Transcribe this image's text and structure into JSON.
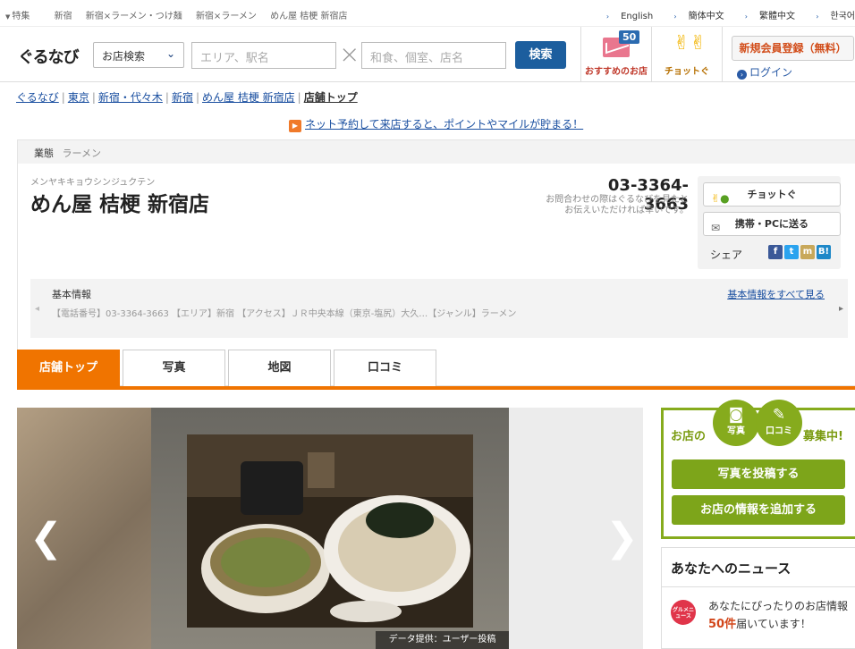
{
  "topbar": {
    "links": [
      "特集",
      "新宿",
      "新宿×ラーメン・つけ麺",
      "新宿×ラーメン",
      "めん屋 桔梗 新宿店"
    ],
    "languages": [
      "English",
      "簡体中文",
      "繁體中文",
      "한국어"
    ]
  },
  "header": {
    "logo": "ぐるなび",
    "search_mode": "お店検索",
    "area_placeholder": "エリア、駅名",
    "keyword_placeholder": "和食、個室、店名",
    "search_button": "検索",
    "recommend_label": "おすすめのお店",
    "recommend_count": "50",
    "chotto_label": "チョットぐ",
    "register_button": "新規会員登録（無料）",
    "login_link": "ログイン"
  },
  "breadcrumb": [
    "ぐるなび",
    "東京",
    "新宿・代々木",
    "新宿",
    "めん屋 桔梗 新宿店",
    "店舗トップ"
  ],
  "promo": "ネット予約して来店すると、ポイントやマイルが貯まる！",
  "shop": {
    "category_key": "業態",
    "category_value": "ラーメン",
    "kana": "メンヤキキョウシンジュクテン",
    "name": "めん屋 桔梗 新宿店",
    "tel": "03-3364-3663",
    "tel_note_1": "お問合わせの際はぐるなびを見たと",
    "tel_note_2": "お伝えいただければ幸いです。"
  },
  "actions": {
    "chotto": "チョットぐ",
    "send": "携帯・PCに送る",
    "share": "シェア"
  },
  "basic_info": {
    "title": "基本情報",
    "more": "基本情報をすべて見る",
    "text": "【電話番号】03-3364-3663 【エリア】新宿 【アクセス】ＪＲ中央本線（東京-塩尻）大久…【ジャンル】ラーメン"
  },
  "tabs": [
    "店舗トップ",
    "写真",
    "地図",
    "口コミ"
  ],
  "carousel": {
    "credit": "データ提供：ユーザー投稿"
  },
  "post": {
    "prefix": "お店の",
    "photo": "写真",
    "review": "口コミ",
    "suffix": "募集中!",
    "post_photo_button": "写真を投稿する",
    "add_info_button": "お店の情報を追加する"
  },
  "news": {
    "title": "あなたへのニュース",
    "icon_text": "グルメニュース",
    "line1": "あなたにぴったりのお店情報",
    "count": "50件",
    "line2_suffix": "届いています！"
  },
  "colors": {
    "accent_orange": "#f07400",
    "brand_blue": "#1c5e9e",
    "green": "#86ab1d"
  }
}
